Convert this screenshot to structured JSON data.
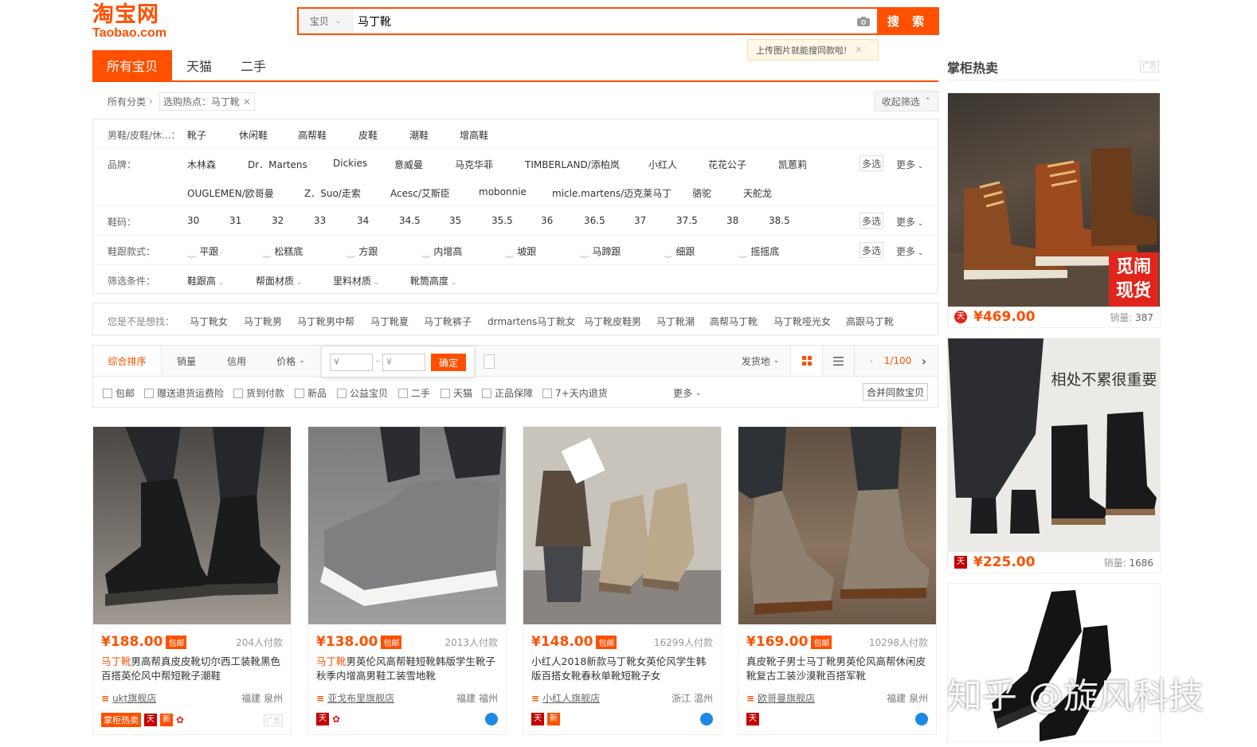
{
  "header": {
    "logo_cn": "淘宝网",
    "logo_en": "Taobao.com",
    "search_category": "宝贝",
    "search_value": "马丁靴",
    "search_button": "搜 索",
    "upload_tip": "上传图片就能搜同款啦!"
  },
  "tabs": [
    "所有宝贝",
    "天猫",
    "二手"
  ],
  "breadcrumb": {
    "root": "所有分类",
    "tag": "选购热点：马丁靴",
    "collapse": "收起筛选"
  },
  "filters": {
    "category": {
      "label": "男鞋/皮鞋/休...：",
      "items": [
        "靴子",
        "休闲鞋",
        "高帮鞋",
        "皮鞋",
        "潮鞋",
        "增高鞋"
      ]
    },
    "brand": {
      "label": "品牌：",
      "row1": [
        "木林森",
        "Dr．Martens",
        "Dickies",
        "意威曼",
        "马克华菲",
        "TIMBERLAND/添柏岚",
        "小红人",
        "花花公子",
        "凯蒽莉"
      ],
      "row2": [
        "OUGLEMEN/欧哥曼",
        "Z．Suo/走索",
        "Acesc/艾斯臣",
        "mobonnie",
        "micle.martens/迈克莱马丁",
        "骆驼",
        "天舵龙"
      ]
    },
    "size": {
      "label": "鞋码：",
      "items": [
        "30",
        "31",
        "32",
        "33",
        "34",
        "34.5",
        "35",
        "35.5",
        "36",
        "36.5",
        "37",
        "37.5",
        "38",
        "38.5"
      ]
    },
    "heel": {
      "label": "鞋跟款式：",
      "items": [
        "平跟",
        "松糕底",
        "方跟",
        "内增高",
        "坡跟",
        "马蹄跟",
        "细跟",
        "摇摇底"
      ]
    },
    "conditions": {
      "label": "筛选条件：",
      "items": [
        "鞋跟高",
        "帮面材质",
        "里料材质",
        "靴筒高度"
      ]
    },
    "multi": "多选",
    "more": "更多"
  },
  "suggest": {
    "label": "您是不是想找：",
    "items": [
      "马丁靴女",
      "马丁靴男",
      "马丁靴男中帮",
      "马丁靴夏",
      "马丁靴裤子",
      "drmartens马丁靴女",
      "马丁靴皮鞋男",
      "马丁靴潮",
      "高帮马丁靴",
      "马丁靴哑光女",
      "高跟马丁靴"
    ]
  },
  "sort": {
    "items": [
      "综合排序",
      "销量",
      "信用",
      "价格"
    ],
    "price_placeholder": "¥",
    "confirm": "确定",
    "ship_from": "发货地",
    "pager": "1/100"
  },
  "checks": {
    "items": [
      "包邮",
      "赠送退货运费险",
      "货到付款",
      "新品",
      "公益宝贝",
      "二手",
      "天猫",
      "正品保障",
      "7+天内退货"
    ],
    "more": "更多",
    "merge": "合并同款宝贝"
  },
  "products": [
    {
      "price": "¥188.00",
      "badge": "包邮",
      "paid": "204人付款",
      "title_hl": "马丁靴",
      "title": "男高帮真皮皮靴切尔西工装靴黑色百搭英伦风中帮短靴子潮鞋",
      "shop": "ukt旗舰店",
      "loc": "福建 泉州",
      "tag": "掌柜热卖",
      "ad": "广告"
    },
    {
      "price": "¥138.00",
      "badge": "包邮",
      "paid": "2013人付款",
      "title_hl": "马丁靴",
      "title": "男英伦风高帮鞋短靴韩版学生靴子秋季内增高男鞋工装雪地靴",
      "shop": "亚戈布里旗舰店",
      "loc": "福建 福州"
    },
    {
      "price": "¥148.00",
      "badge": "包邮",
      "paid": "16299人付款",
      "title_hl": "马丁靴",
      "title": "小红人2018新款马丁靴女英伦风学生韩版百搭女靴春秋单靴短靴子女",
      "shop": "小红人旗舰店",
      "loc": "浙江 温州"
    },
    {
      "price": "¥169.00",
      "badge": "包邮",
      "paid": "10298人付款",
      "title_hl": "马丁靴",
      "title": "真皮靴子男士马丁靴男英伦风高帮休闲皮靴复古工装沙漠靴百搭军靴",
      "shop": "欧哥曼旗舰店",
      "loc": "福建 泉州"
    }
  ],
  "side": {
    "title": "掌柜热卖",
    "ad": "广告",
    "items": [
      {
        "price": "¥469.00",
        "sales_label": "销量:",
        "sales": "387",
        "overlay": "觅闹现货"
      },
      {
        "price": "¥225.00",
        "sales_label": "销量:",
        "sales": "1686",
        "overlay": "相处不累很重要"
      }
    ]
  },
  "watermark": "知乎 @旋风科技",
  "colors": {
    "accent": "#ff5000"
  }
}
